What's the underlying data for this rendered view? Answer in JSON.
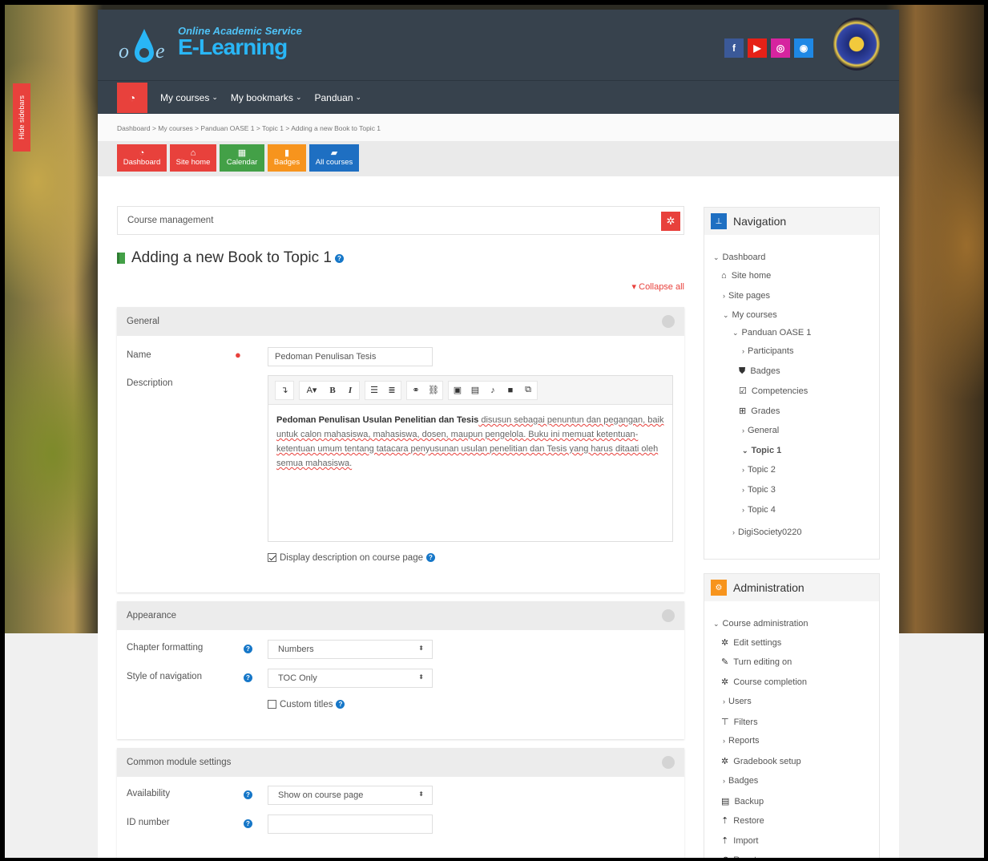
{
  "sidebar_toggle": "Hide sidebars",
  "header": {
    "logo_sub": "Online Academic Service",
    "logo_main": "E-Learning",
    "socials": [
      {
        "icon": "facebook-icon",
        "glyph": "f",
        "color": "#3b5998"
      },
      {
        "icon": "youtube-icon",
        "glyph": "▶",
        "color": "#e62117"
      },
      {
        "icon": "instagram-icon",
        "glyph": "◎",
        "color": "#d6249f"
      },
      {
        "icon": "globe-icon",
        "glyph": "◉",
        "color": "#1e88e5"
      }
    ]
  },
  "navbar": {
    "items": [
      "My courses",
      "My bookmarks",
      "Panduan"
    ]
  },
  "breadcrumb": "Dashboard > My courses > Panduan OASE 1 > Topic 1 > Adding a new Book to Topic 1",
  "quick_buttons": [
    {
      "label": "Dashboard",
      "color": "#e8413c",
      "glyph": "◔"
    },
    {
      "label": "Site home",
      "color": "#e8413c",
      "glyph": "⌂"
    },
    {
      "label": "Calendar",
      "color": "#43a047",
      "glyph": "▦"
    },
    {
      "label": "Badges",
      "color": "#f7941d",
      "glyph": "▮"
    },
    {
      "label": "All courses",
      "color": "#1e6fc2",
      "glyph": "▰"
    }
  ],
  "course_management": "Course management",
  "page_title": "Adding a new Book to Topic 1",
  "collapse_all": "Collapse all",
  "general": {
    "heading": "General",
    "name_label": "Name",
    "name_value": "Pedoman Penulisan Tesis",
    "description_label": "Description",
    "editor_bold": "Pedoman Penulisan Usulan Penelitian dan Tesis",
    "editor_rest": " disusun sebagai penuntun dan pegangan, baik untuk calon mahasiswa, mahasiswa, dosen, maupun pengelola. Buku ini memuat ketentuan-ketentuan umum tentang tatacara penyusunan usulan penelitian dan Tesis yang harus ditaati oleh semua mahasiswa.",
    "display_desc": "Display description on course page"
  },
  "appearance": {
    "heading": "Appearance",
    "chapter_label": "Chapter formatting",
    "chapter_value": "Numbers",
    "nav_label": "Style of navigation",
    "nav_value": "TOC Only",
    "custom_titles": "Custom titles"
  },
  "common": {
    "heading": "Common module settings",
    "availability_label": "Availability",
    "availability_value": "Show on course page",
    "idnumber_label": "ID number"
  },
  "navigation_block": {
    "title": "Navigation",
    "items": [
      "Dashboard",
      "Site home",
      "Site pages",
      "My courses",
      "Panduan OASE 1",
      "Participants",
      "Badges",
      "Competencies",
      "Grades",
      "General",
      "Topic 1",
      "Topic 2",
      "Topic 3",
      "Topic 4",
      "DigiSociety0220"
    ]
  },
  "admin_block": {
    "title": "Administration",
    "items": [
      "Course administration",
      "Edit settings",
      "Turn editing on",
      "Course completion",
      "Users",
      "Filters",
      "Reports",
      "Gradebook setup",
      "Badges",
      "Backup",
      "Restore",
      "Import",
      "Reset"
    ]
  }
}
